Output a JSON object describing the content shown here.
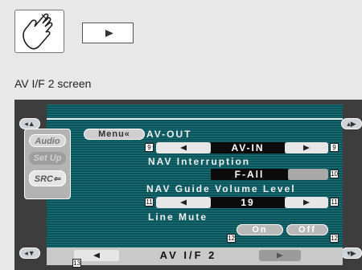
{
  "caption": "AV I/F 2 screen",
  "left_panel": {
    "menu_label": "Menu«",
    "audio_label": "Audio",
    "setup_label": "Set Up",
    "src_label": "SRC"
  },
  "settings": {
    "av_out_label": "AV-OUT",
    "av_out_value": "AV-IN",
    "nav_interruption_label": "NAV Interruption",
    "nav_interruption_value": "F-All",
    "nav_guide_volume_label": "NAV Guide Volume Level",
    "nav_guide_volume_value": "19",
    "line_mute_label": "Line Mute",
    "on_label": "On",
    "off_label": "Off"
  },
  "footer": {
    "title": "AV I/F 2"
  },
  "callouts": [
    "9",
    "9",
    "10",
    "11",
    "11",
    "12",
    "12",
    "13"
  ],
  "icons": [
    "hand-touch-icon",
    "play-icon",
    "arrow-left-icon",
    "arrow-right-icon"
  ]
}
